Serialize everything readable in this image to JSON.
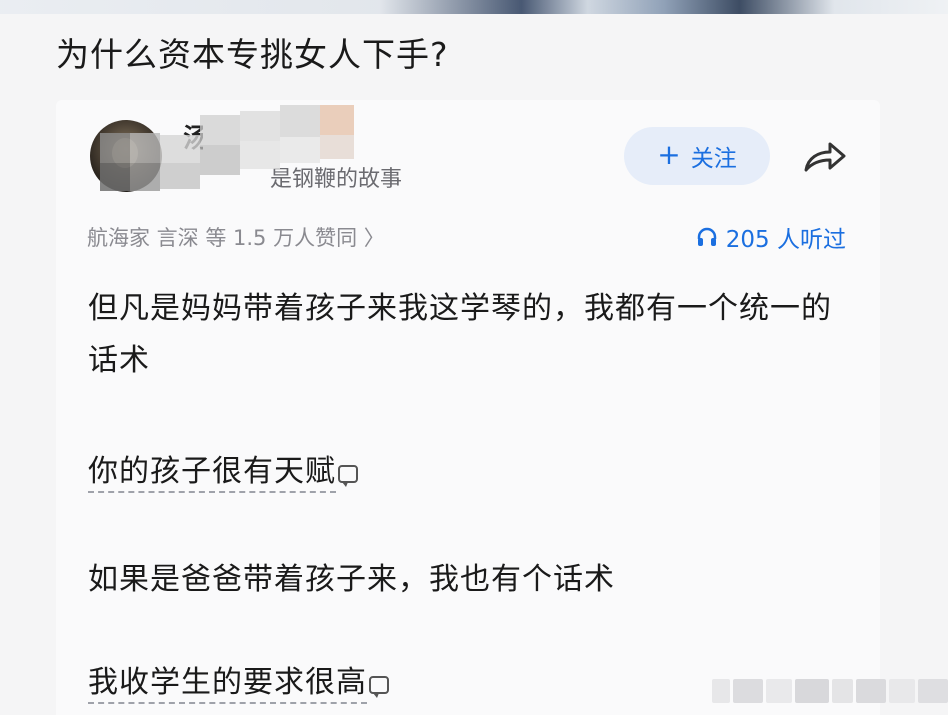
{
  "question": {
    "title": "为什么资本专挑女人下手?"
  },
  "author": {
    "name": "汤汤",
    "bio": "是钢鞭的故事"
  },
  "actions": {
    "follow_plus": "+",
    "follow_label": "关注"
  },
  "answer_meta": {
    "upvoters": "航海家 言深 等 1.5 万人赞同 〉",
    "listen_count": "205 人听过"
  },
  "content": {
    "para1": "但凡是妈妈带着孩子来我这学琴的，我都有一个统一的话术",
    "para2": "你的孩子很有天赋",
    "para3": "如果是爸爸带着孩子来，我也有个话术",
    "para4": "我收学生的要求很高"
  },
  "colors": {
    "accent": "#1b6fe0",
    "follow_bg": "#e6edf9",
    "meta_text": "#8a8a90"
  },
  "icons": {
    "share": "share-arrow-icon",
    "headphones": "headphones-icon",
    "comment": "comment-icon"
  }
}
